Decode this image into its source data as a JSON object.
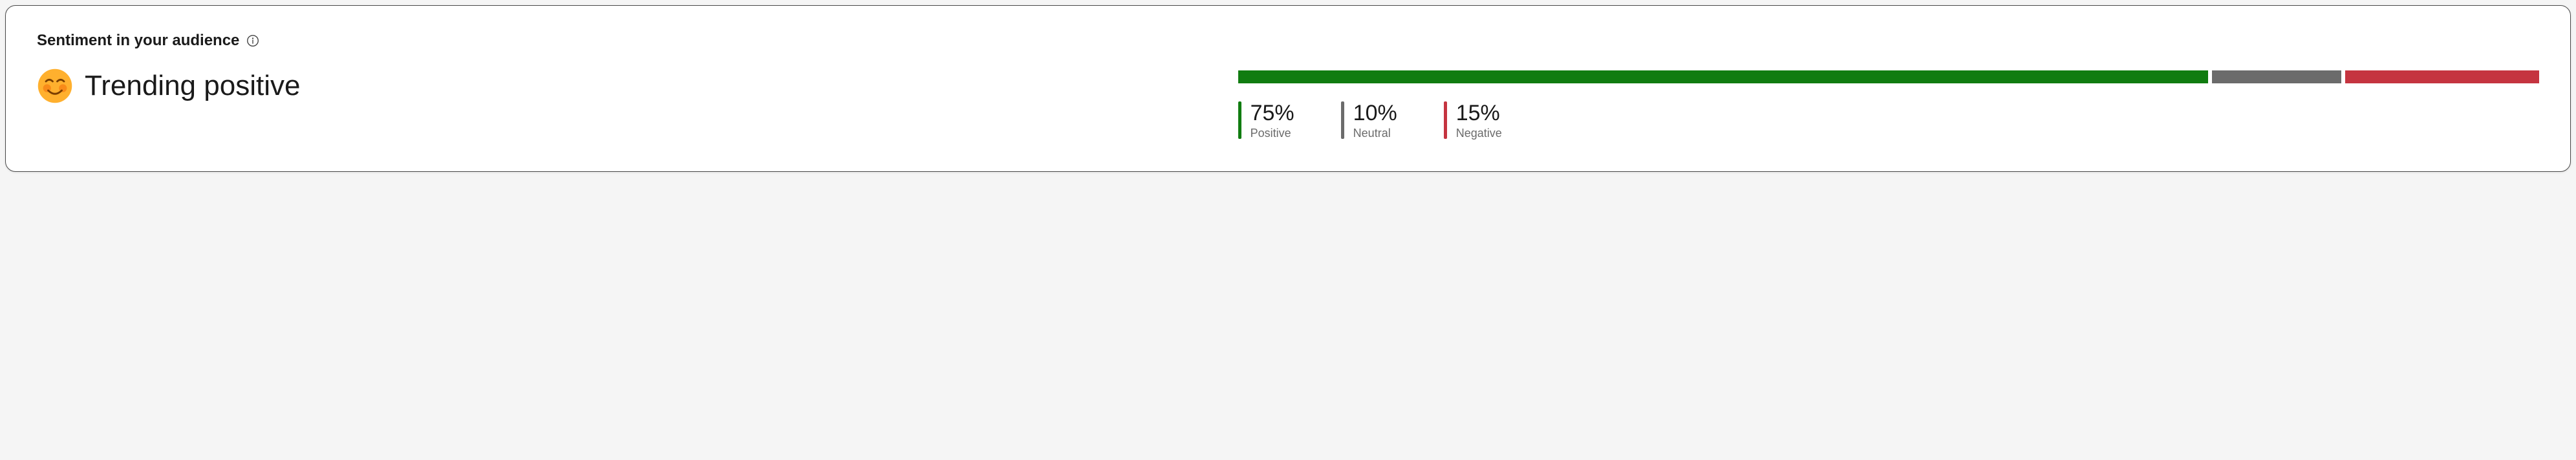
{
  "card": {
    "title": "Sentiment in your audience",
    "trend_label": "Trending positive"
  },
  "chart_data": {
    "type": "bar",
    "title": "Sentiment in your audience",
    "series": [
      {
        "name": "Positive",
        "value": 75,
        "display": "75%",
        "color": "#107c10"
      },
      {
        "name": "Neutral",
        "value": 10,
        "display": "10%",
        "color": "#6b6b6b"
      },
      {
        "name": "Negative",
        "value": 15,
        "display": "15%",
        "color": "#c53440"
      }
    ],
    "ylim": [
      0,
      100
    ]
  }
}
